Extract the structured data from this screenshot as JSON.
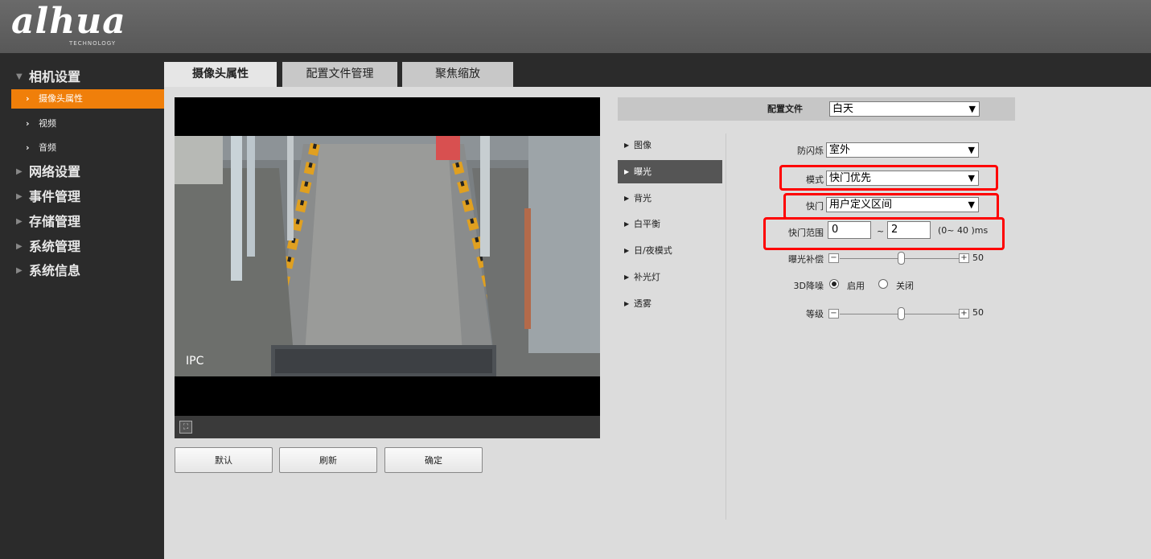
{
  "brand": {
    "logo": "alhua",
    "sub": "TECHNOLOGY"
  },
  "sidebar": {
    "groups": [
      {
        "label": "相机设置",
        "expanded": true
      },
      {
        "label": "网络设置"
      },
      {
        "label": "事件管理"
      },
      {
        "label": "存储管理"
      },
      {
        "label": "系统管理"
      },
      {
        "label": "系统信息"
      }
    ],
    "sub_items": [
      {
        "label": "摄像头属性",
        "active": true
      },
      {
        "label": "视频"
      },
      {
        "label": "音频"
      }
    ]
  },
  "tabs": [
    {
      "label": "摄像头属性",
      "active": true
    },
    {
      "label": "配置文件管理"
    },
    {
      "label": "聚焦缩放"
    }
  ],
  "video": {
    "overlay_text": "IPC"
  },
  "buttons": {
    "default": "默认",
    "refresh": "刷新",
    "confirm": "确定"
  },
  "profile": {
    "label": "配置文件",
    "value": "白天"
  },
  "menu": [
    "图像",
    "曝光",
    "背光",
    "白平衡",
    "日/夜模式",
    "补光灯",
    "透雾"
  ],
  "menu_active": "曝光",
  "fields": {
    "anti_flicker": {
      "label": "防闪烁",
      "value": "室外"
    },
    "mode": {
      "label": "模式",
      "value": "快门优先"
    },
    "shutter": {
      "label": "快门",
      "value": "用户定义区间"
    },
    "shutter_range": {
      "label": "快门范围",
      "min": "0",
      "sep": "~",
      "max": "2",
      "hint": "(0~ 40 )ms"
    },
    "exposure_comp": {
      "label": "曝光补偿",
      "value": "50",
      "level": 50
    },
    "dnr": {
      "label": "3D降噪",
      "on_label": "启用",
      "off_label": "关闭",
      "selected": "启用"
    },
    "level": {
      "label": "等级",
      "value": "50",
      "level": 50
    }
  },
  "colors": {
    "accent": "#f07f0a",
    "highlight": "#ff0000",
    "menu_active": "#555555"
  },
  "icons": {
    "slider_minus": "−",
    "slider_plus": "+",
    "fullscreen": "⛶"
  }
}
